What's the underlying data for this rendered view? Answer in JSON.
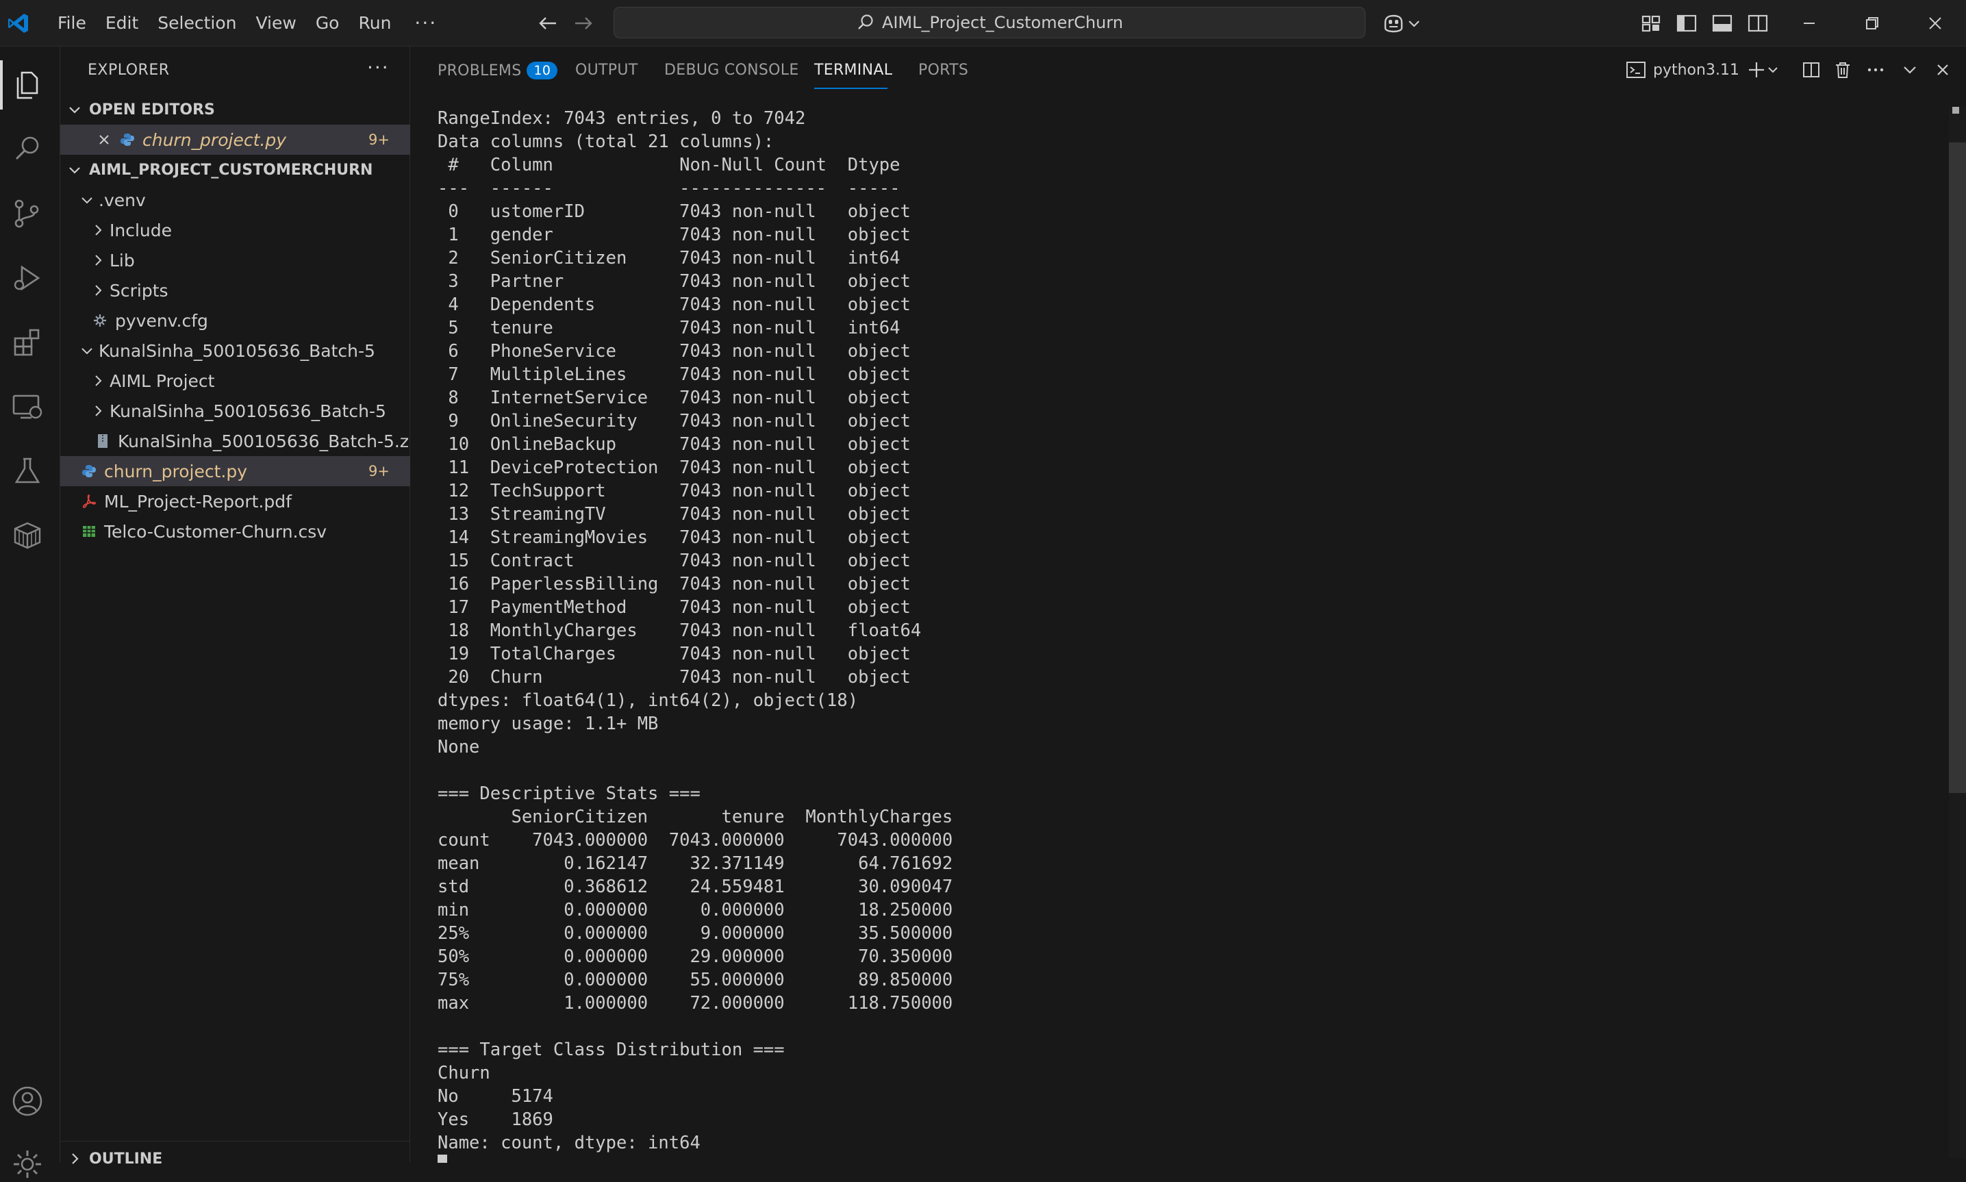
{
  "titlebar": {
    "menu": [
      "File",
      "Edit",
      "Selection",
      "View",
      "Go",
      "Run"
    ],
    "more": "···",
    "search_text": "AIML_Project_CustomerChurn"
  },
  "explorer": {
    "title": "EXPLORER",
    "more": "···",
    "open_editors": {
      "header": "OPEN EDITORS",
      "items": [
        {
          "name": "churn_project.py",
          "badge": "9+"
        }
      ]
    },
    "project": {
      "header": "AIML_PROJECT_CUSTOMERCHURN",
      "rows": [
        {
          "label": ".venv"
        },
        {
          "label": "Include"
        },
        {
          "label": "Lib"
        },
        {
          "label": "Scripts"
        },
        {
          "label": "pyvenv.cfg"
        },
        {
          "label": "KunalSinha_500105636_Batch-5"
        },
        {
          "label": "AIML Project"
        },
        {
          "label": "KunalSinha_500105636_Batch-5"
        },
        {
          "label": "KunalSinha_500105636_Batch-5.zip"
        },
        {
          "label": "churn_project.py",
          "badge": "9+"
        },
        {
          "label": "ML_Project-Report.pdf"
        },
        {
          "label": "Telco-Customer-Churn.csv"
        }
      ]
    },
    "outline": "OUTLINE"
  },
  "panel": {
    "tabs": [
      {
        "label": "PROBLEMS",
        "badge": "10"
      },
      {
        "label": "OUTPUT"
      },
      {
        "label": "DEBUG CONSOLE"
      },
      {
        "label": "TERMINAL"
      },
      {
        "label": "PORTS"
      }
    ],
    "terminal_name": "python3.11"
  },
  "terminal": {
    "lines": [
      "RangeIndex: 7043 entries, 0 to 7042",
      "Data columns (total 21 columns):",
      " #   Column            Non-Null Count  Dtype  ",
      "---  ------            --------------  -----  ",
      " 0   ustomerID         7043 non-null   object ",
      " 1   gender            7043 non-null   object ",
      " 2   SeniorCitizen     7043 non-null   int64  ",
      " 3   Partner           7043 non-null   object ",
      " 4   Dependents        7043 non-null   object ",
      " 5   tenure            7043 non-null   int64  ",
      " 6   PhoneService      7043 non-null   object ",
      " 7   MultipleLines     7043 non-null   object ",
      " 8   InternetService   7043 non-null   object ",
      " 9   OnlineSecurity    7043 non-null   object ",
      " 10  OnlineBackup      7043 non-null   object ",
      " 11  DeviceProtection  7043 non-null   object ",
      " 12  TechSupport       7043 non-null   object ",
      " 13  StreamingTV       7043 non-null   object ",
      " 14  StreamingMovies   7043 non-null   object ",
      " 15  Contract          7043 non-null   object ",
      " 16  PaperlessBilling  7043 non-null   object ",
      " 17  PaymentMethod     7043 non-null   object ",
      " 18  MonthlyCharges    7043 non-null   float64",
      " 19  TotalCharges      7043 non-null   object ",
      " 20  Churn             7043 non-null   object ",
      "dtypes: float64(1), int64(2), object(18)",
      "memory usage: 1.1+ MB",
      "None",
      "",
      "=== Descriptive Stats ===",
      "       SeniorCitizen       tenure  MonthlyCharges",
      "count    7043.000000  7043.000000     7043.000000",
      "mean        0.162147    32.371149       64.761692",
      "std         0.368612    24.559481       30.090047",
      "min         0.000000     0.000000       18.250000",
      "25%         0.000000     9.000000       35.500000",
      "50%         0.000000    29.000000       70.350000",
      "75%         0.000000    55.000000       89.850000",
      "max         1.000000    72.000000      118.750000",
      "",
      "=== Target Class Distribution ===",
      "Churn",
      "No     5174",
      "Yes    1869",
      "Name: count, dtype: int64"
    ]
  }
}
